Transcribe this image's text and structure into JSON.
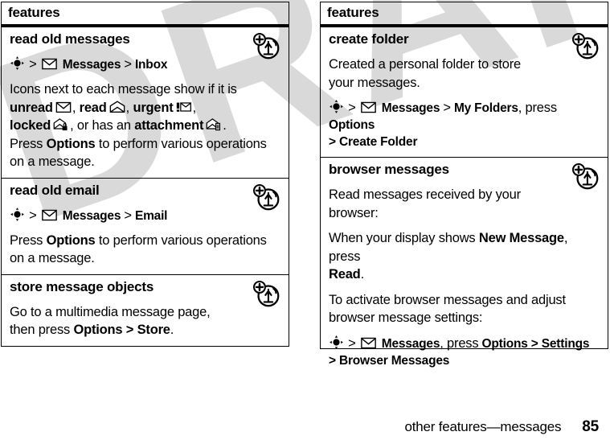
{
  "document": {
    "watermark": "DRAFT",
    "footer": {
      "section": "other features—messages",
      "page_number": "85"
    }
  },
  "icons": {
    "feature_marker": "a-plus-circle-icon",
    "navigation_key": "navigation-key-icon",
    "messages_menu": "envelope-icon",
    "unread": "closed-envelope-icon",
    "read": "open-envelope-icon",
    "urgent": "urgent-envelope-icon",
    "locked": "locked-envelope-icon",
    "attachment": "attachment-envelope-icon"
  },
  "left_table": {
    "header": "features",
    "rows": [
      {
        "title": "read old messages",
        "nav_path": {
          "prefix": "",
          "menu": "Messages",
          "sep1": ">",
          "sep2": ">",
          "target": "Inbox"
        },
        "body": {
          "line1": "Icons next to each message show if it is",
          "unread_label": "unread",
          "read_label": "read",
          "urgent_label": "urgent",
          "locked_label": "locked",
          "mid_text": ", or has an",
          "attachment_label": "attachment",
          "press": "Press",
          "options_label": "Options",
          "tail": "to perform various operations on a message."
        }
      },
      {
        "title": "read old email",
        "nav_path": {
          "menu": "Messages",
          "target": "Email"
        },
        "body": {
          "press": "Press",
          "options_label": "Options",
          "tail": "to perform various operations on a message."
        }
      },
      {
        "title": "store message objects",
        "body": {
          "line1": "Go to a multimedia message page,",
          "line2_pre": "then press",
          "options_label": "Options",
          "sep": ">",
          "store_label": "Store",
          "period": "."
        }
      }
    ]
  },
  "right_table": {
    "header": "features",
    "rows": [
      {
        "title": "create folder",
        "body": {
          "line1": "Created a personal folder to store",
          "line2": "your messages."
        },
        "nav_path": {
          "menu": "Messages",
          "folders": "My Folders",
          "press": ", press",
          "options_label": "Options",
          "sep": ">",
          "create_folder": "Create Folder"
        }
      },
      {
        "title": "browser messages",
        "body": {
          "p1_line1": "Read messages received by your",
          "p1_line2": "browser:",
          "p2_pre": "When your display shows",
          "p2_bold": "New Message",
          "p2_mid": ", press",
          "p2_bold2": "Read",
          "p2_end": ".",
          "p3_line1": "To activate browser messages and adjust",
          "p3_line2": "browser message settings:"
        },
        "nav_path": {
          "menu": "Messages",
          "press": ", press",
          "options_label": "Options",
          "sep": ">",
          "settings": "Settings",
          "sep2": ">",
          "browser_messages": "Browser Messages"
        }
      }
    ]
  },
  "colors": {
    "ink": "#000000",
    "watermark": "#d9d9d9",
    "page": "#ffffff"
  }
}
